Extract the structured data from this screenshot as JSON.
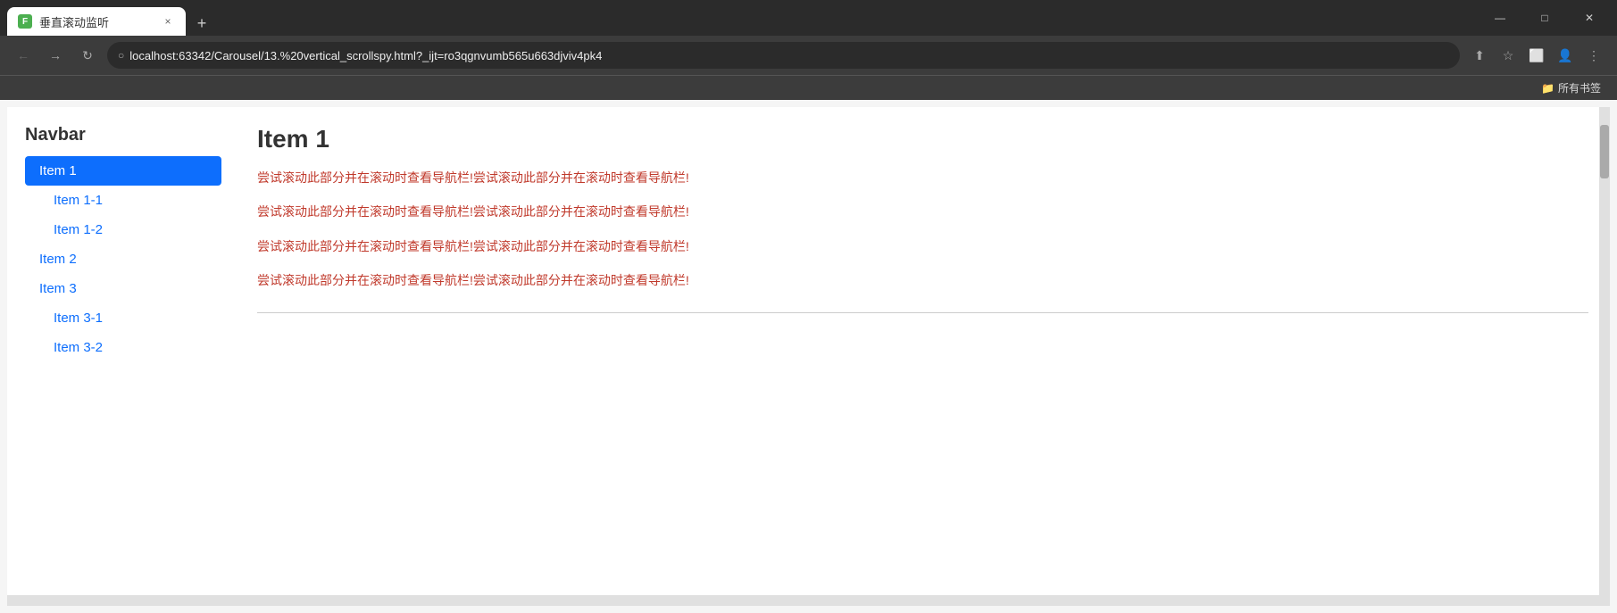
{
  "browser": {
    "tab_title": "垂直滚动监听",
    "favicon_text": "F",
    "close_tab_label": "×",
    "new_tab_label": "+",
    "window_controls": {
      "minimize": "—",
      "maximize": "□",
      "close": "✕"
    },
    "nav": {
      "back_label": "←",
      "forward_label": "→",
      "refresh_label": "↻"
    },
    "address": "localhost:63342/Carousel/13.%20vertical_scrollspy.html?_ijt=ro3qgnvumb565u663djviv4pk4",
    "address_icon": "○",
    "toolbar_actions": {
      "share": "⬆",
      "bookmark": "☆",
      "tablet": "⬜",
      "profile": "👤",
      "menu": "⋮"
    },
    "bookmarks_label": "所有书签",
    "bookmarks_icon": "📁"
  },
  "page": {
    "navbar_title": "Navbar",
    "nav_items": [
      {
        "label": "Item 1",
        "active": true,
        "level": 0
      },
      {
        "label": "Item 1-1",
        "active": false,
        "level": 1
      },
      {
        "label": "Item 1-2",
        "active": false,
        "level": 1
      },
      {
        "label": "Item 2",
        "active": false,
        "level": 0
      },
      {
        "label": "Item 3",
        "active": false,
        "level": 0
      },
      {
        "label": "Item 3-1",
        "active": false,
        "level": 1
      },
      {
        "label": "Item 3-2",
        "active": false,
        "level": 1
      }
    ],
    "section_title": "Item 1",
    "paragraphs": [
      "尝试滚动此部分并在滚动时查看导航栏!尝试滚动此部分并在滚动时查看导航栏!",
      "尝试滚动此部分并在滚动时查看导航栏!尝试滚动此部分并在滚动时查看导航栏!",
      "尝试滚动此部分并在滚动时查看导航栏!尝试滚动此部分并在滚动时查看导航栏!",
      "尝试滚动此部分并在滚动时查看导航栏!尝试滚动此部分并在滚动时查看导航栏!"
    ]
  }
}
